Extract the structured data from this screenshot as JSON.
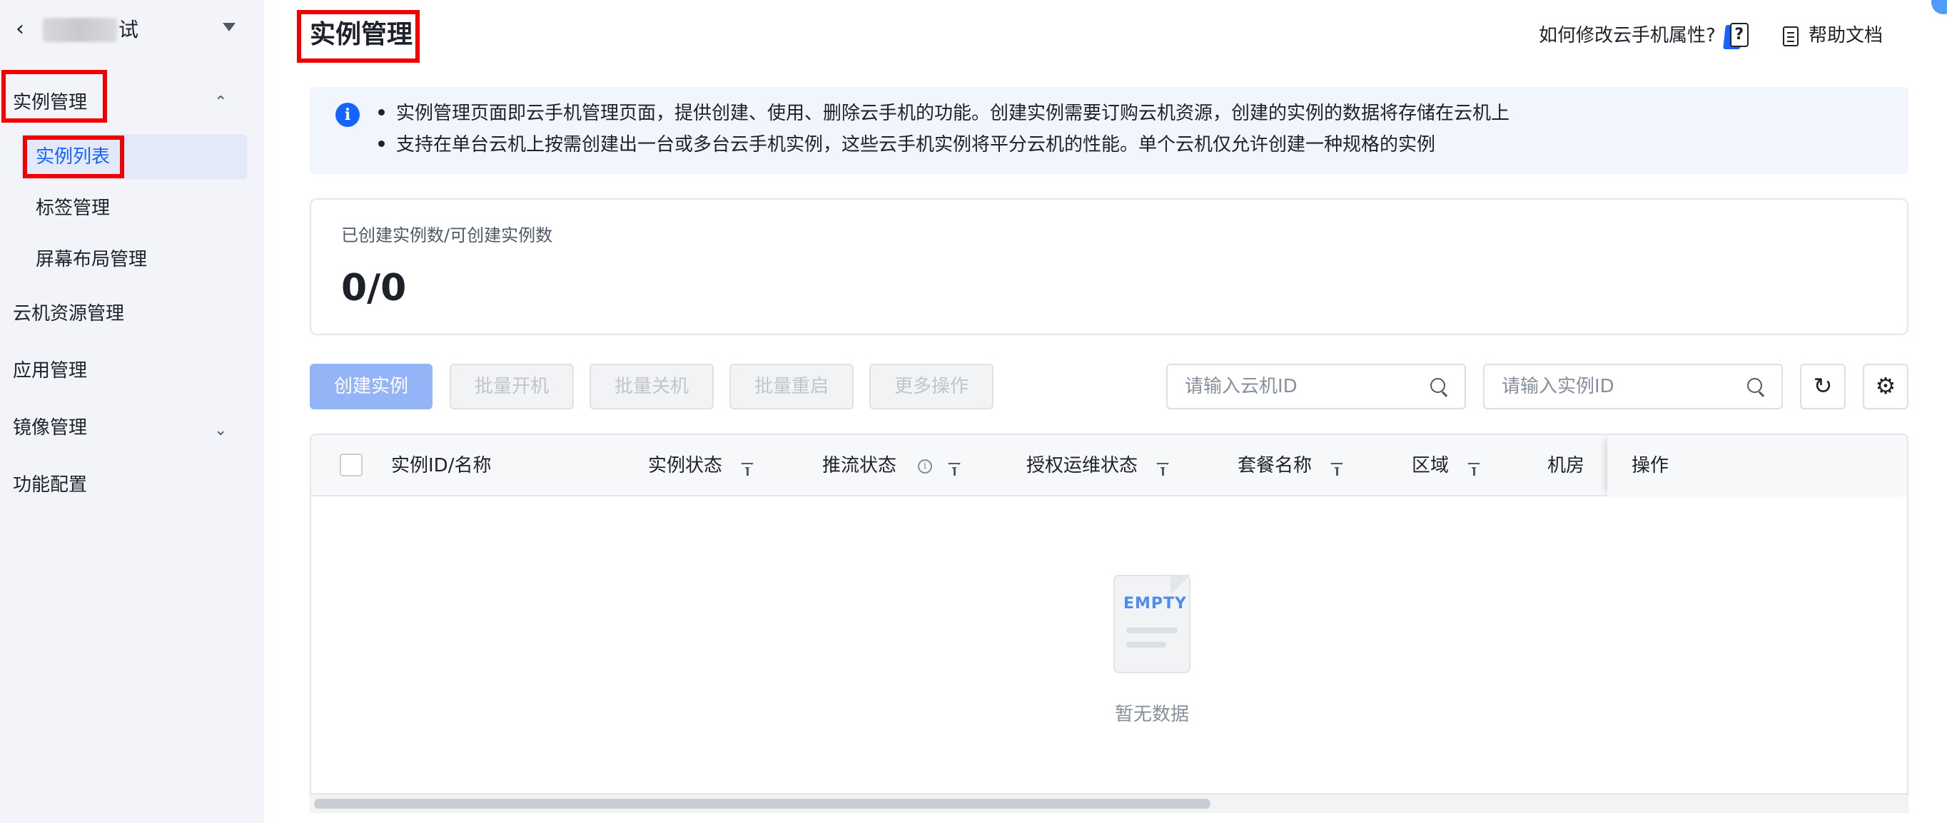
{
  "sidebar": {
    "account_name_tail": "试",
    "groups": [
      {
        "label": "实例管理",
        "expanded": true
      },
      {
        "label": "云机资源管理"
      },
      {
        "label": "应用管理"
      },
      {
        "label": "镜像管理",
        "expanded": false
      },
      {
        "label": "功能配置"
      }
    ],
    "sub_items": [
      {
        "label": "实例列表",
        "active": true
      },
      {
        "label": "标签管理"
      },
      {
        "label": "屏幕布局管理"
      }
    ]
  },
  "header": {
    "title": "实例管理",
    "help_question": "如何修改云手机属性?",
    "help_badge": "?",
    "help_doc": "帮助文档"
  },
  "notice": {
    "icon": "i",
    "lines": [
      "实例管理页面即云手机管理页面，提供创建、使用、删除云手机的功能。创建实例需要订购云机资源，创建的实例的数据将存储在云机上",
      "支持在单台云机上按需创建出一台或多台云手机实例，这些云手机实例将平分云机的性能。单个云机仅允许创建一种规格的实例"
    ]
  },
  "stats": {
    "label": "已创建实例数/可创建实例数",
    "value": "0/0"
  },
  "toolbar": {
    "create": "创建实例",
    "batch_start": "批量开机",
    "batch_stop": "批量关机",
    "batch_restart": "批量重启",
    "more": "更多操作",
    "cloud_id_placeholder": "请输入云机ID",
    "instance_id_placeholder": "请输入实例ID"
  },
  "table": {
    "columns": {
      "id_name": "实例ID/名称",
      "status": "实例状态",
      "stream": "推流状态",
      "auth": "授权运维状态",
      "package": "套餐名称",
      "region": "区域",
      "room": "机房",
      "actions": "操作"
    },
    "empty_label": "EMPTY",
    "empty_text": "暂无数据"
  },
  "colors": {
    "accent": "#1664ff",
    "annotation": "#f00000"
  }
}
